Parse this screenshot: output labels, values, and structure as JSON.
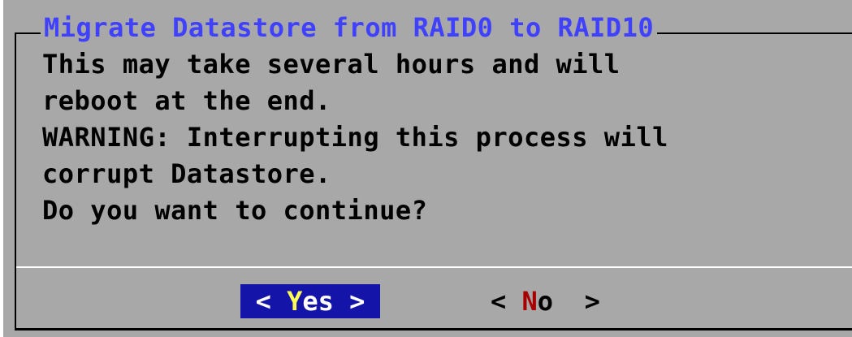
{
  "dialog": {
    "title": "Migrate Datastore from RAID0 to RAID10",
    "message": "This may take several hours and will\nreboot at the end.\nWARNING: Interrupting this process will\ncorrupt Datastore.\nDo you want to continue?",
    "buttons": {
      "yes": {
        "open": "< ",
        "hotkey": "Y",
        "rest": "es",
        "close": " >"
      },
      "no": {
        "open": "< ",
        "hotkey": "N",
        "rest": "o",
        "close": "  >"
      }
    }
  },
  "colors": {
    "dialog_bg": "#a8a8a8",
    "title_fg": "#4040ff",
    "selected_button_bg": "#1414a8",
    "selected_hotkey": "#ffff55",
    "unselected_hotkey": "#a80000"
  }
}
